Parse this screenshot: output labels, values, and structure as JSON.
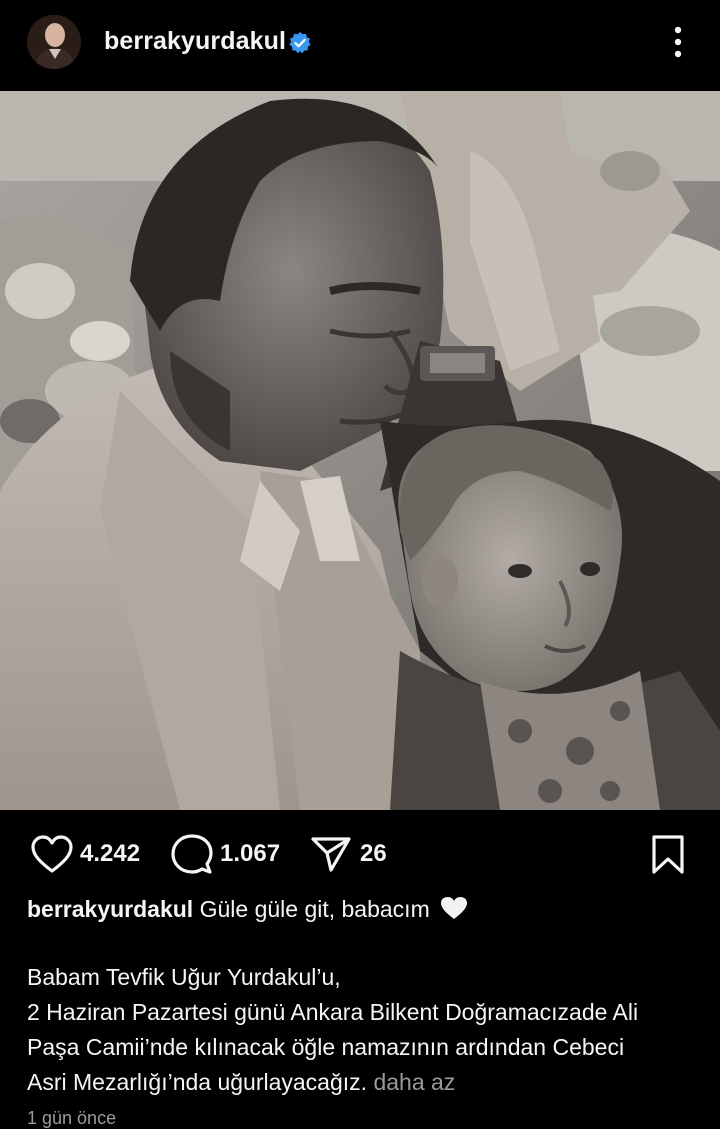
{
  "post": {
    "username": "berrakyurdakul",
    "verified": true,
    "image_alt": "Black-and-white photo of a man holding a baby",
    "likes": "4.242",
    "comments": "1.067",
    "shares": "26",
    "caption_title": "Güle güle git, babacım",
    "caption_lines": [
      "Babam Tevfik Uğur Yurdakul’u,",
      "2 Haziran Pazartesi günü Ankara Bilkent Doğramacızade Ali",
      "Paşa Camii’nde kılınacak öğle namazının ardından Cebeci",
      "Asri Mezarlığı’nda uğurlayacağız."
    ],
    "less_link": "daha az",
    "timestamp": "1 gün önce"
  },
  "icons": {
    "avatar": "avatar",
    "verified": "verified-badge-icon",
    "more": "more-options-icon",
    "like": "heart-icon",
    "comment": "comment-icon",
    "share": "share-icon",
    "save": "bookmark-icon"
  },
  "colors": {
    "background": "#000000",
    "text": "#f5f5f5",
    "muted": "#9a9a9a",
    "verified_blue": "#3897f0"
  }
}
